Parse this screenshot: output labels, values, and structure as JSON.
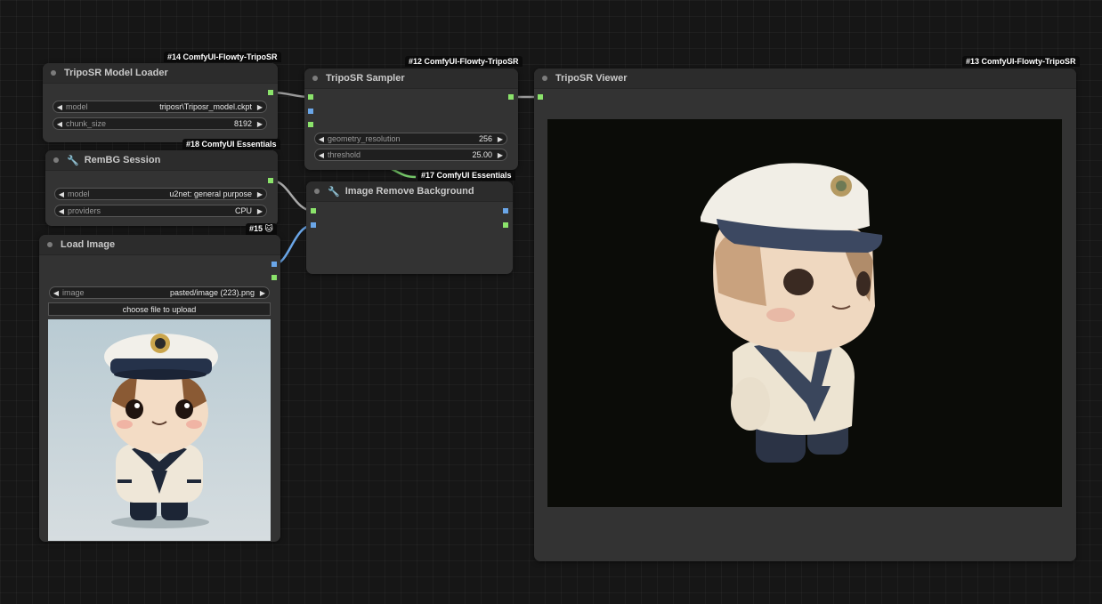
{
  "canvas": {
    "background": "#161616",
    "link_colors": {
      "model": "#9a9a9a",
      "session": "#a9a9a9",
      "image": "#6aa6e8",
      "mask": "#76c96a"
    }
  },
  "nodes": {
    "model_loader": {
      "badge": "#14 ComfyUI-Flowty-TripoSR",
      "title": "TripoSR Model Loader",
      "widgets": [
        {
          "name": "model",
          "value": "triposr\\Triposr_model.ckpt"
        },
        {
          "name": "chunk_size",
          "value": "8192"
        }
      ]
    },
    "rembg_session": {
      "badge": "#18 ComfyUI Essentials",
      "title": "RemBG Session",
      "icon": "wrench-icon",
      "widgets": [
        {
          "name": "model",
          "value": "u2net: general purpose"
        },
        {
          "name": "providers",
          "value": "CPU"
        }
      ]
    },
    "load_image": {
      "badge": "#15 🐱",
      "title": "Load Image",
      "widgets": [
        {
          "name": "image",
          "value": "pasted/image (223).png"
        }
      ],
      "upload_button": "choose file to upload",
      "preview": "chibi-sailor-figure-image"
    },
    "sampler": {
      "badge": "#12 ComfyUI-Flowty-TripoSR",
      "title": "TripoSR Sampler",
      "widgets": [
        {
          "name": "geometry_resolution",
          "value": "256"
        },
        {
          "name": "threshold",
          "value": "25.00"
        }
      ]
    },
    "remove_bg": {
      "badge": "#17 ComfyUI Essentials",
      "title": "Image Remove Background",
      "icon": "wrench-icon"
    },
    "viewer": {
      "badge": "#13 ComfyUI-Flowty-TripoSR",
      "title": "TripoSR Viewer",
      "viewport": "3d-mesh-viewport",
      "viewport_bg": "#0b0c08"
    }
  }
}
